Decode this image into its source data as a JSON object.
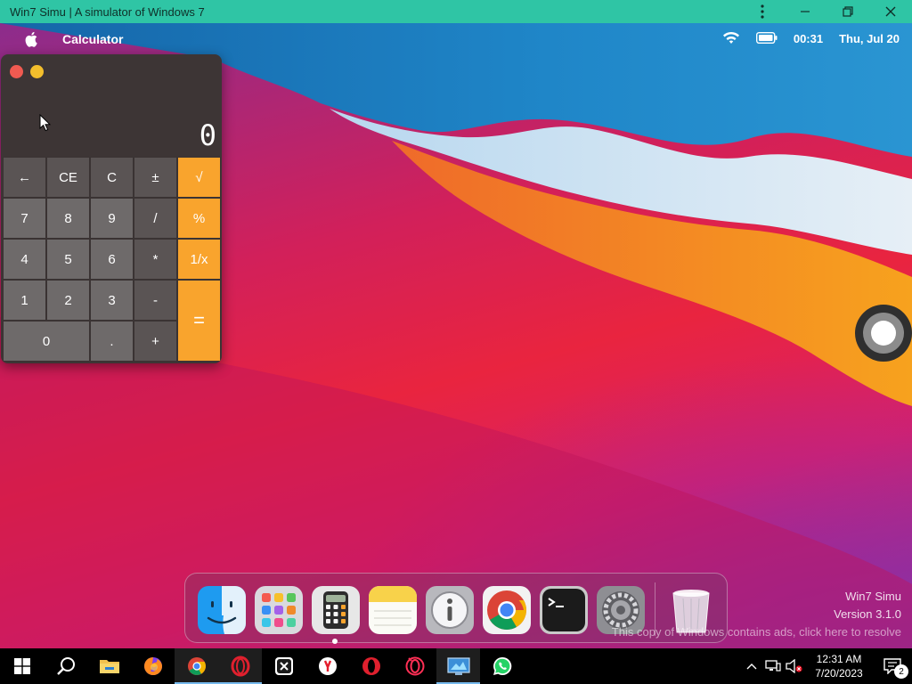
{
  "host_window": {
    "title": "Win7 Simu | A simulator of Windows 7",
    "menu_icon": "more-vertical-icon",
    "minimize_icon": "minimize-icon",
    "restore_icon": "restore-icon",
    "close_icon": "close-icon"
  },
  "menubar": {
    "logo_icon": "apple-icon",
    "app_name": "Calculator",
    "wifi_icon": "wifi-icon",
    "battery_icon": "battery-icon",
    "time": "00:31",
    "date": "Thu, Jul 20"
  },
  "calculator": {
    "display": "0",
    "keys": [
      "←",
      "CE",
      "C",
      "±",
      "√",
      "7",
      "8",
      "9",
      "/",
      "%",
      "4",
      "5",
      "6",
      "*",
      "1/x",
      "1",
      "2",
      "3",
      "-",
      "=",
      "0",
      ".",
      "+"
    ],
    "accent_color": "#f9a42d"
  },
  "dock": {
    "apps": [
      "finder-icon",
      "launchpad-icon",
      "calculator-icon",
      "notes-icon",
      "info-icon",
      "chrome-icon",
      "terminal-icon",
      "settings-icon",
      "trash-icon"
    ]
  },
  "watermark": {
    "name": "Win7 Simu",
    "version": "Version 3.1.0",
    "ads_notice": "This copy of Windows contains ads, click here to resolve"
  },
  "taskbar": {
    "items": [
      "windows-start-icon",
      "search-icon",
      "file-explorer-icon",
      "firefox-icon",
      "chrome-icon",
      "opera-icon",
      "xbrowser-icon",
      "yandex-icon",
      "opera-red-icon",
      "opera-gx-icon",
      "control-panel-icon",
      "whatsapp-icon"
    ],
    "clock_time": "12:31 AM",
    "clock_date": "7/20/2023",
    "notification_count": "2"
  }
}
